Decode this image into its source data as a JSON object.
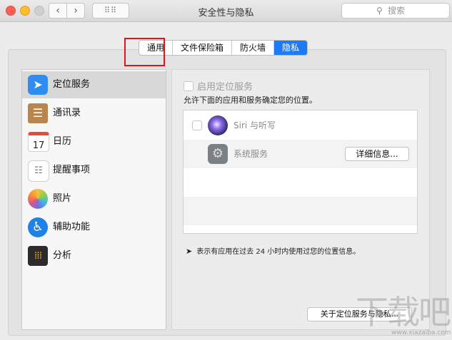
{
  "window": {
    "title": "安全性与隐私"
  },
  "toolbar": {
    "back": "‹",
    "forward": "›",
    "grid": "⠿⠿",
    "search_placeholder": "搜索"
  },
  "tabs": [
    {
      "label": "通用",
      "active": false
    },
    {
      "label": "文件保险箱",
      "active": false
    },
    {
      "label": "防火墙",
      "active": false
    },
    {
      "label": "隐私",
      "active": true
    }
  ],
  "sidebar": {
    "items": [
      {
        "label": "定位服务",
        "icon": "location-arrow-icon",
        "selected": true
      },
      {
        "label": "通讯录",
        "icon": "contacts-book-icon",
        "selected": false
      },
      {
        "label": "日历",
        "icon": "calendar-icon",
        "day": "17",
        "selected": false
      },
      {
        "label": "提醒事项",
        "icon": "reminders-icon",
        "selected": false
      },
      {
        "label": "照片",
        "icon": "photos-icon",
        "selected": false
      },
      {
        "label": "辅助功能",
        "icon": "accessibility-icon",
        "selected": false
      },
      {
        "label": "分析",
        "icon": "analytics-icon",
        "selected": false
      }
    ]
  },
  "location": {
    "enable_label": "启用定位服务",
    "allow_text": "允许下面的应用和服务确定您的位置。",
    "apps": [
      {
        "label": "Siri 与听写",
        "icon": "siri-icon"
      },
      {
        "label": "系统服务",
        "icon": "system-gear-icon",
        "button": "详细信息..."
      }
    ],
    "note": "表示有应用在过去 24 小时内使用过您的位置信息。",
    "about_button": "关于定位服务与隐私..."
  },
  "watermark": {
    "text": "下载吧",
    "url": "www.xiazaiba.com"
  },
  "colors": {
    "accent": "#1d7cf4",
    "highlight_box": "#e0141c"
  }
}
